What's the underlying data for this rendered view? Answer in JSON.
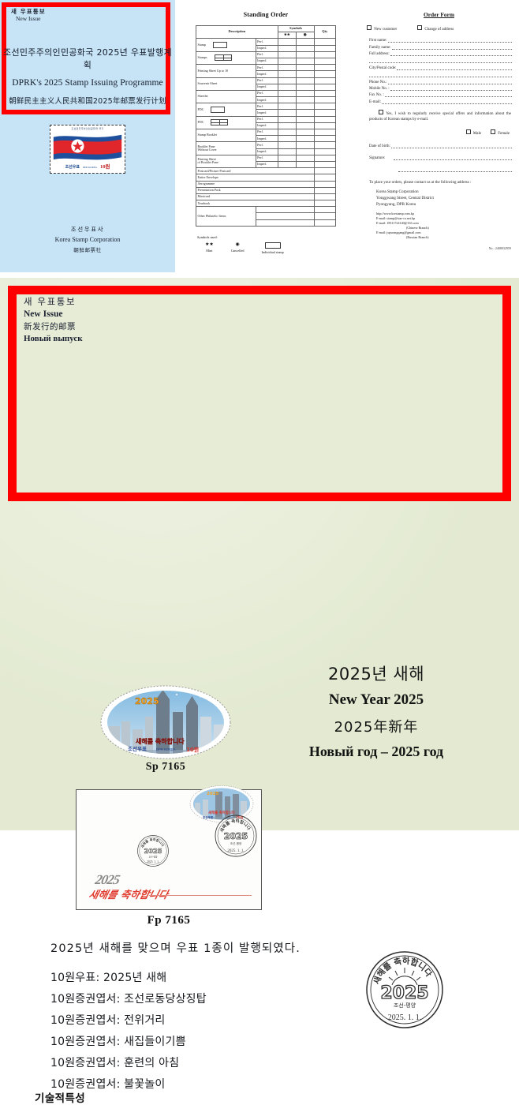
{
  "cover": {
    "new_issue_ko": "새 우표통보",
    "new_issue_en": "New Issue",
    "title_ko": "조선민주주의인민공화국 2025년 우표발행계획",
    "title_en": "DPRK's 2025 Stamp Issuing Programme",
    "title_zh": "朝鲜民主主义人民共和国2025年邮票发行计划",
    "stamp": {
      "top_text": "조선민주주의인민공화국 국기",
      "country_ko": "조선우표",
      "country_en": "DPR KOREA",
      "value": "10원"
    },
    "footer_ko": "조선우표사",
    "footer_en": "Korea Stamp Corporation",
    "footer_zh": "朝鲜邮票社"
  },
  "standing_order": {
    "title": "Standing Order",
    "headers": {
      "description": "Description",
      "symbols": "Symbols",
      "qty": "Qty",
      "sym_mint": "★★",
      "sym_cancelled": "◉"
    },
    "rows": [
      {
        "desc": "Stamp",
        "icon": "single-rect",
        "variants": [
          "Perf.",
          "Imperf."
        ]
      },
      {
        "desc": "Stamps",
        "icon": "block-rect",
        "variants": [
          "Perf.",
          "Imperf."
        ]
      },
      {
        "desc": "Printing Sheet Up to 10",
        "icon": "",
        "variants": [
          "Perf.",
          "Imperf."
        ]
      },
      {
        "desc": "Souvenir Sheet",
        "icon": "",
        "variants": [
          "Perf.",
          "Imperf."
        ]
      },
      {
        "desc": "Sheetlet",
        "icon": "",
        "variants": [
          "Perf.",
          "Imperf."
        ]
      },
      {
        "desc": "FDC",
        "icon": "single-rect",
        "variants": [
          "Perf.",
          "Imperf."
        ]
      },
      {
        "desc": "FDC",
        "icon": "block-rect",
        "variants": [
          "Perf.",
          "Imperf."
        ]
      },
      {
        "desc": "Stamp Booklet",
        "icon": "",
        "variants": [
          "Perf.",
          "Imperf."
        ]
      },
      {
        "desc": "Booklet Pane Without Cover",
        "icon": "",
        "variants": [
          "Perf.",
          "Imperf."
        ]
      },
      {
        "desc": "Printing Sheet of Booklet Pane",
        "icon": "",
        "variants": [
          "Perf.",
          "Imperf."
        ]
      }
    ],
    "simple_rows": [
      "Postcard/Picture Postcard",
      "Entire Envelope",
      "Aerogramme",
      "Presentation Pack",
      "Maxicard",
      "Yearbook"
    ],
    "other_label": "Other Philatelic Items",
    "symbols_used_label": "Symbols used:",
    "legend": [
      {
        "glyph": "★★",
        "label": "Mint"
      },
      {
        "glyph": "◉",
        "label": "Cancelled"
      },
      {
        "glyph": "box",
        "label": "Individual stamp"
      }
    ]
  },
  "order_form": {
    "title": "Order Form",
    "new_customer": "New customer",
    "change_of_address": "Change of address",
    "fields": [
      "First name:",
      "Family name:",
      "Full address:",
      "City/Postal code:",
      "Phone No.:",
      "Mobile No. :",
      "Fax No. :",
      "E-mail:"
    ],
    "optin": "Yes, I wish to regularly receive special offers and information about the products of Korean stamps by e-mail.",
    "gender": [
      "Male",
      "Female"
    ],
    "date_of_birth": "Date of birth:",
    "signature": "Signature:",
    "contact_intro": "To place your orders, please contact us at the following address :",
    "address": [
      "Korea Stamp Corporation",
      "Yonggwang Street, Central District",
      "Pyongyang, DPR Korea"
    ],
    "links": [
      {
        "text": "http://www.korstamp.com.kp",
        "indent": false
      },
      {
        "text": "E-mail: stamp@star-co.net.kp",
        "indent": false
      },
      {
        "text": "E-mail: 18511724140@163.com",
        "indent": false
      },
      {
        "text": "(Chinese Branch)",
        "indent": true
      },
      {
        "text": "E-mail: jupwangqang@gmail.com",
        "indent": false
      },
      {
        "text": "(Russian Branch)",
        "indent": true
      }
    ],
    "ref_no": "No.: 2408032959"
  },
  "news_sheet": {
    "header": {
      "ko": "새 우표통보",
      "en": "New Issue",
      "zh": "新发行的邮票",
      "ru": "Новый выпуск"
    },
    "titles": {
      "ko": "2025년 새해",
      "en": "New Year 2025",
      "zh": "2025年新年",
      "ru": "Новый год – 2025 год"
    },
    "stamp_code": "Sp 7165",
    "fdc_code": "Fp 7165",
    "stamp": {
      "year_badge": "2025",
      "greeting": "새해를 축하합니다",
      "country_ko": "조선우표",
      "country_en": "DPR KOREA",
      "value": "10원"
    },
    "fdc": {
      "signature_year": "2025",
      "signature_script": "새해를 축하합니다"
    },
    "postmark": {
      "top": "새해를 축하합니다",
      "year": "2025",
      "place": "조선-평양",
      "date": "2025. 1. 1."
    },
    "lead": "2025년 새해를 맞으며 우표 1종이 발행되였다.",
    "items": [
      "10원우표: 2025년 새해",
      "10원증권엽서: 조선로동당상징탑",
      "10원증권엽서: 전위거리",
      "10원증권엽서: 새집들이기쁨",
      "10원증권엽서: 훈련의 아침",
      "10원증권엽서: 불꽃놀이"
    ],
    "tech_heading": "기술적특성"
  },
  "colors": {
    "red_border": "#ff0000",
    "cover_blue": "#c6e4f5",
    "sheet_green": "#e3ead1",
    "flag_red": "#e0262b",
    "flag_blue": "#1d4f9c"
  }
}
